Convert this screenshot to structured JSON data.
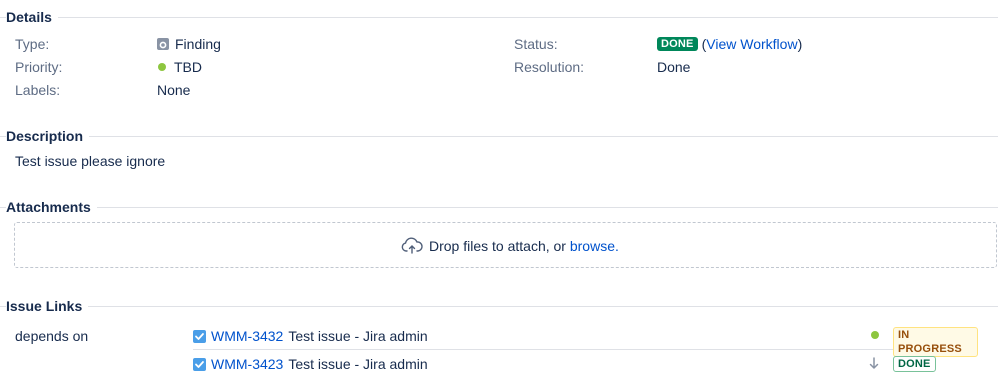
{
  "details": {
    "title": "Details",
    "type_label": "Type:",
    "type_value": "Finding",
    "priority_label": "Priority:",
    "priority_value": "TBD",
    "labels_label": "Labels:",
    "labels_value": "None",
    "status_label": "Status:",
    "status_value": "DONE",
    "status_open_paren": "(",
    "view_workflow": "View Workflow",
    "status_close_paren": ")",
    "resolution_label": "Resolution:",
    "resolution_value": "Done"
  },
  "description": {
    "title": "Description",
    "text": "Test issue please ignore"
  },
  "attachments": {
    "title": "Attachments",
    "drop_text": "Drop files to attach, or ",
    "browse_link": "browse."
  },
  "issue_links": {
    "title": "Issue Links",
    "relation": "depends on",
    "links": [
      {
        "key": "WMM-3432",
        "summary": "Test issue - Jira admin",
        "status": "IN PROGRESS"
      },
      {
        "key": "WMM-3423",
        "summary": "Test issue - Jira admin",
        "status": "DONE"
      }
    ]
  },
  "colors": {
    "link": "#0052cc",
    "done_green": "#00875a",
    "priority_green": "#8dc63f",
    "checkbox_blue": "#4a9ee8"
  }
}
